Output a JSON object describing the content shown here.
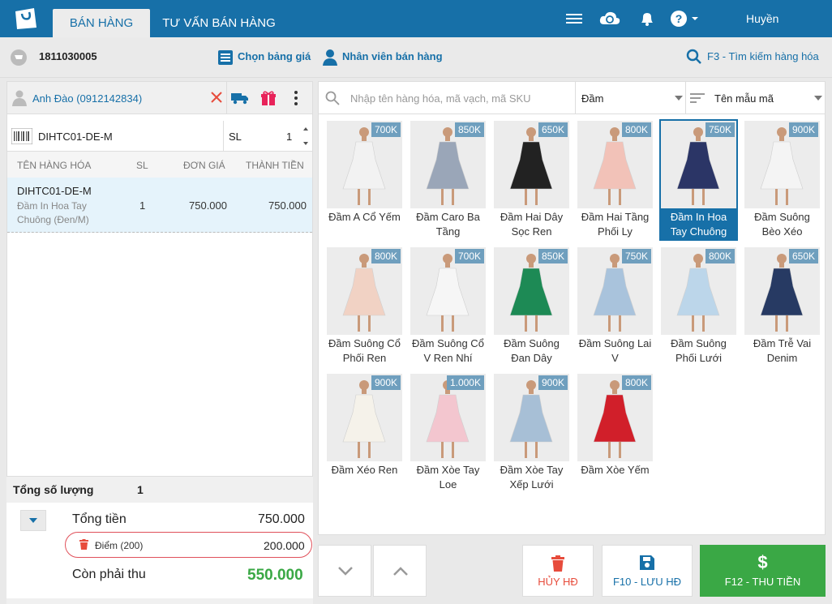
{
  "topbar": {
    "tabs": [
      {
        "label": "BÁN HÀNG"
      },
      {
        "label": "TƯ VẤN BÁN HÀNG"
      }
    ],
    "user": "Huyền",
    "icons": [
      "menu-icon",
      "cloud-sync-icon",
      "bell-icon",
      "help-icon"
    ]
  },
  "secbar": {
    "invoice_id": "1811030005",
    "price_list_label": "Chọn bảng giá",
    "staff_label": "Nhân viên bán hàng",
    "search_label": "F3 - Tìm kiếm hàng hóa"
  },
  "customer": {
    "name": "Anh Đào (0912142834)"
  },
  "code_input": {
    "value": "DIHTC01-DE-M",
    "qty_label": "SL",
    "qty": "1"
  },
  "table": {
    "headers": [
      "TÊN HÀNG HÓA",
      "SL",
      "ĐƠN GIÁ",
      "THÀNH TIỀN"
    ],
    "rows": [
      {
        "code": "DIHTC01-DE-M",
        "desc1": "Đầm In Hoa Tay",
        "desc2": "Chuông (Đen/M)",
        "qty": "1",
        "price": "750.000",
        "total": "750.000"
      }
    ]
  },
  "totals": {
    "qty_label": "Tổng số lượng",
    "qty": "1",
    "total_label": "Tổng tiền",
    "total": "750.000",
    "points_label": "Điểm (200)",
    "points": "200.000",
    "due_label": "Còn phải thu",
    "due": "550.000"
  },
  "search": {
    "placeholder": "Nhập tên hàng hóa, mã vạch, mã SKU",
    "category": "Đầm",
    "sort": "Tên mẫu mã"
  },
  "products": [
    {
      "price": "700K",
      "name1": "Đầm A Cổ Yếm",
      "name2": "",
      "color": "#f2f2f2"
    },
    {
      "price": "850K",
      "name1": "Đầm Caro Ba",
      "name2": "Tầng",
      "color": "#9aa6b8"
    },
    {
      "price": "650K",
      "name1": "Đầm Hai Dây",
      "name2": "Sọc Ren",
      "color": "#222222"
    },
    {
      "price": "800K",
      "name1": "Đầm Hai Tầng",
      "name2": "Phối Ly",
      "color": "#f2c2b8"
    },
    {
      "price": "750K",
      "name1": "Đầm In Hoa",
      "name2": "Tay Chuông",
      "color": "#2b3566"
    },
    {
      "price": "900K",
      "name1": "Đầm Suông",
      "name2": "Bèo Xéo",
      "color": "#f4f4f4"
    },
    {
      "price": "800K",
      "name1": "Đầm Suông Cổ",
      "name2": "Phối Ren",
      "color": "#f1d2c4"
    },
    {
      "price": "700K",
      "name1": "Đầm Suông Cổ",
      "name2": "V Ren Nhí",
      "color": "#f6f6f6"
    },
    {
      "price": "850K",
      "name1": "Đầm Suông",
      "name2": "Đan Dây",
      "color": "#1d8a55"
    },
    {
      "price": "750K",
      "name1": "Đầm Suông Lai",
      "name2": "V",
      "color": "#a9c3dc"
    },
    {
      "price": "800K",
      "name1": "Đầm Suông",
      "name2": "Phối Lưới",
      "color": "#bcd6ea"
    },
    {
      "price": "650K",
      "name1": "Đầm Trễ Vai",
      "name2": "Denim",
      "color": "#273a63"
    },
    {
      "price": "900K",
      "name1": "Đầm Xéo Ren",
      "name2": "",
      "color": "#f5f2ea"
    },
    {
      "price": "1.000K",
      "name1": "Đầm Xòe Tay",
      "name2": "Loe",
      "color": "#f3c6cf"
    },
    {
      "price": "900K",
      "name1": "Đầm Xòe Tay",
      "name2": "Xếp Lưới",
      "color": "#a7bfd6"
    },
    {
      "price": "800K",
      "name1": "Đầm Xòe Yếm",
      "name2": "",
      "color": "#d11f2a"
    }
  ],
  "bottom": {
    "cancel": "HỦY HĐ",
    "save": "F10 - LƯU HĐ",
    "pay": "F12 - THU TIỀN"
  },
  "colors": {
    "primary": "#1770a8",
    "green": "#3aa845",
    "red": "#e74c3c",
    "price_badge": "#6f9fbe"
  }
}
